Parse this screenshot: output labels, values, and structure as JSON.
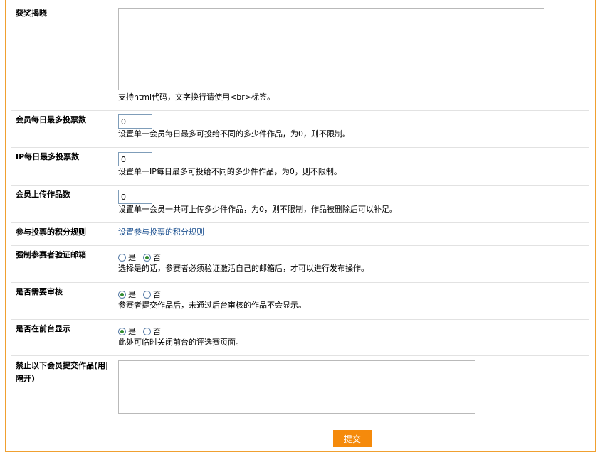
{
  "form": {
    "award_notice": {
      "label": "获奖揭晓",
      "value": "",
      "hint": "支持html代码，文字换行请使用<br>标签。"
    },
    "daily_votes_member": {
      "label": "会员每日最多投票数",
      "value": "0",
      "hint": "设置单一会员每日最多可投给不同的多少件作品，为0，则不限制。"
    },
    "daily_votes_ip": {
      "label": "IP每日最多投票数",
      "value": "0",
      "hint": "设置单一IP每日最多可投给不同的多少件作品，为0，则不限制。"
    },
    "member_upload_count": {
      "label": "会员上传作品数",
      "value": "0",
      "hint": "设置单一会员一共可上传多少件作品，为0，则不限制，作品被删除后可以补足。"
    },
    "vote_points_rule": {
      "label": "参与投票的积分规则",
      "link": "设置参与投票的积分规则"
    },
    "force_email_verify": {
      "label": "强制参赛者验证邮箱",
      "yes": "是",
      "no": "否",
      "selected": "no",
      "hint": "选择是的话，参赛者必须验证激活自己的邮箱后，才可以进行发布操作。"
    },
    "need_review": {
      "label": "是否需要审核",
      "yes": "是",
      "no": "否",
      "selected": "yes",
      "hint": "参赛者提交作品后，未通过后台审核的作品不会显示。"
    },
    "show_frontend": {
      "label": "是否在前台显示",
      "yes": "是",
      "no": "否",
      "selected": "yes",
      "hint": "此处可临时关闭前台的评选赛页面。"
    },
    "banned_members": {
      "label": "禁止以下会员提交作品(用|隔开)",
      "value": ""
    }
  },
  "submit_label": "提交",
  "colors": {
    "border": "#f0a030",
    "button": "#f58a0b",
    "link": "#1a4f8f",
    "radio_dot": "#2f8a2f"
  }
}
